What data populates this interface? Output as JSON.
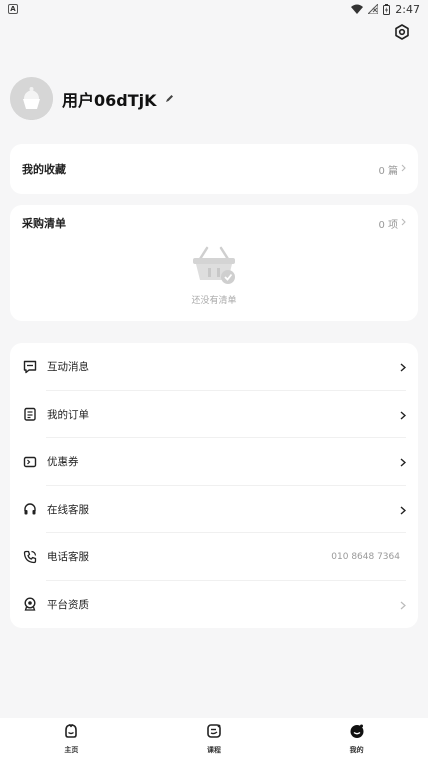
{
  "status_bar": {
    "time": "2:47"
  },
  "profile": {
    "username": "用户06dTjK"
  },
  "favorites": {
    "title": "我的收藏",
    "count": "0 篇"
  },
  "purchase_list": {
    "title": "采购清单",
    "count": "0 项",
    "empty_text": "还没有清单"
  },
  "menu": [
    {
      "label": "互动消息",
      "icon": "message-icon",
      "value": ""
    },
    {
      "label": "我的订单",
      "icon": "order-icon",
      "value": ""
    },
    {
      "label": "优惠券",
      "icon": "coupon-icon",
      "value": ""
    },
    {
      "label": "在线客服",
      "icon": "headset-icon",
      "value": ""
    },
    {
      "label": "电话客服",
      "icon": "phone-icon",
      "value": "010 8648 7364"
    },
    {
      "label": "平台资质",
      "icon": "certificate-icon",
      "value": ""
    }
  ],
  "tabs": [
    {
      "label": "主页",
      "icon": "home-icon"
    },
    {
      "label": "课程",
      "icon": "course-icon"
    },
    {
      "label": "我的",
      "icon": "profile-icon"
    }
  ]
}
